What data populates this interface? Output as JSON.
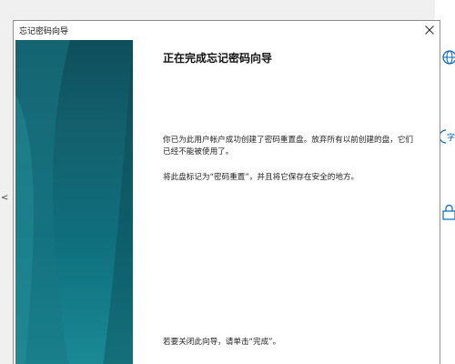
{
  "window": {
    "title": "忘记密码向导",
    "close_glyph": "×"
  },
  "content": {
    "heading": "正在完成忘记密码向导",
    "paragraph1": "你已为此用户帐户成功创建了密码重置盘。放弃所有以前创建的盘，它们已经不能被使用了。",
    "paragraph2": "将此盘标记为“密码重置”，并且将它保存在安全的地方。",
    "paragraph3": "若要关闭此向导，请单击“完成”。"
  },
  "background": {
    "left_mark": "<",
    "icons": [
      "globe-icon",
      "language-icon",
      "lock-icon"
    ],
    "icon_color": "#0067c0"
  },
  "colors": {
    "side_panel_dark": "#0e4e5c",
    "side_panel_light": "#1b8c96"
  }
}
